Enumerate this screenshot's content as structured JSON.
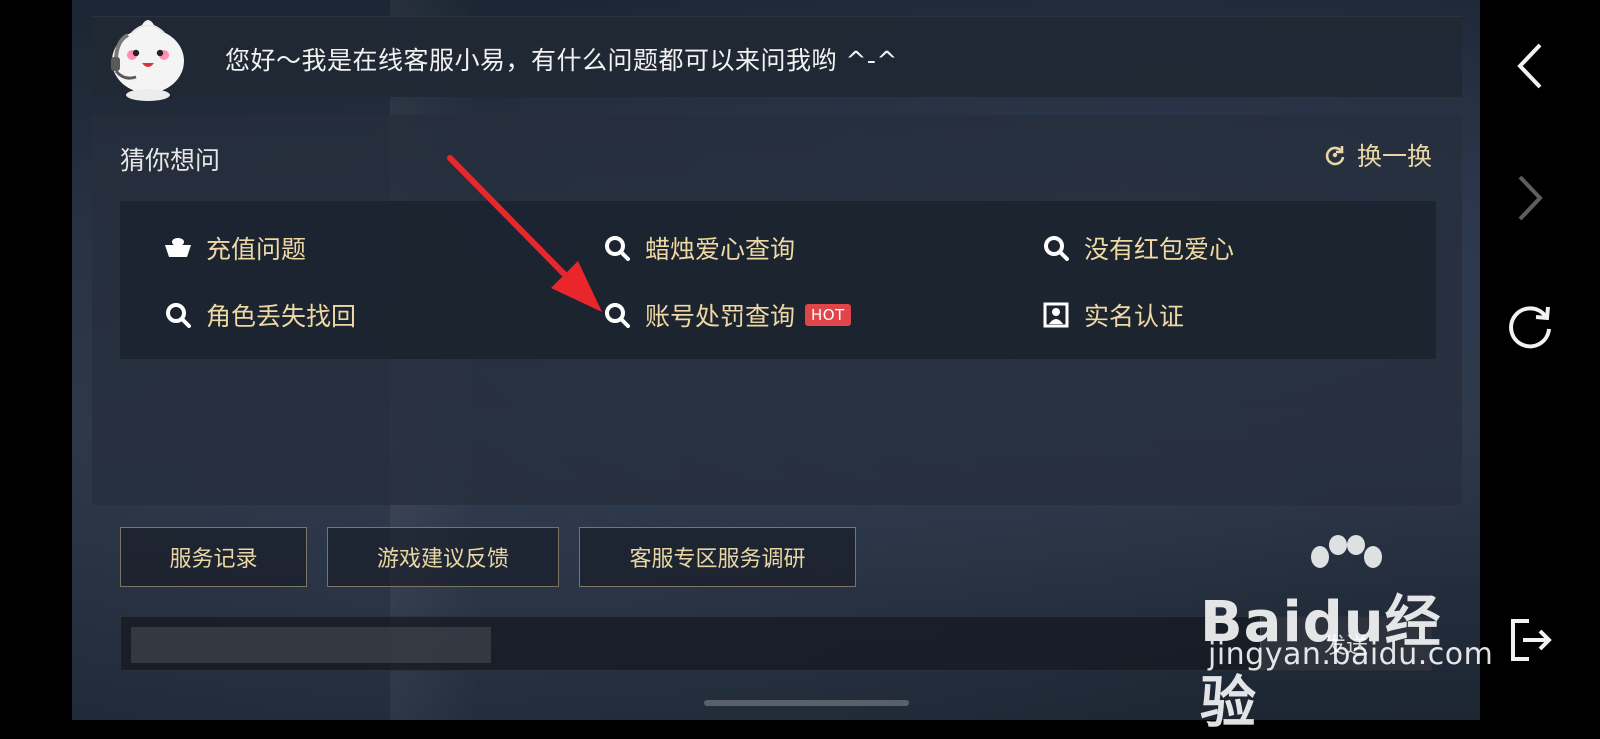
{
  "greeting": {
    "text": "您好～我是在线客服小易，有什么问题都可以来问我哟 ^-^"
  },
  "faq": {
    "title": "猜你想问",
    "refresh_label": "换一换",
    "items": [
      {
        "label": "充值问题",
        "icon": "ingot-icon"
      },
      {
        "label": "蜡烛爱心查询",
        "icon": "search-icon"
      },
      {
        "label": "没有红包爱心",
        "icon": "search-icon"
      },
      {
        "label": "角色丢失找回",
        "icon": "search-icon"
      },
      {
        "label": "账号处罚查询",
        "icon": "search-icon",
        "badge": "HOT"
      },
      {
        "label": "实名认证",
        "icon": "id-card-icon"
      }
    ]
  },
  "buttons": {
    "service_record": "服务记录",
    "game_feedback": "游戏建议反馈",
    "survey": "客服专区服务调研"
  },
  "input": {
    "value": "",
    "placeholder": "",
    "send_label": "发送"
  },
  "watermark": {
    "brand": "Baidu经验",
    "url": "jingyan.baidu.com"
  },
  "colors": {
    "accent_text": "#eed9a4",
    "hot_badge": "#e0454a",
    "annotation_arrow": "#e8262b"
  }
}
